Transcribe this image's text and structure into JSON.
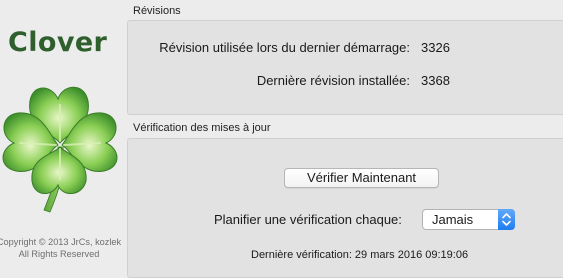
{
  "app": {
    "title": "Clover",
    "copyright_line1": "Copyright © 2013 JrCs, kozlek",
    "copyright_line2": "All Rights Reserved"
  },
  "revisions": {
    "section_title": "Révisions",
    "last_boot_label": "Révision utilisée lors du dernier démarrage:",
    "last_boot_value": "3326",
    "installed_label": "Dernière révision installée:",
    "installed_value": "3368"
  },
  "updates": {
    "section_title": "Vérification des mises à jour",
    "check_now_button": "Vérifier Maintenant",
    "schedule_label": "Planifier une vérification chaque:",
    "schedule_selected": "Jamais",
    "last_check": "Dernière vérification: 29 mars 2016 09:19:06"
  },
  "colors": {
    "brand_green": "#2e5f2c",
    "accent_blue": "#1e7df0"
  },
  "icons": {
    "logo": "clover-leaf-icon",
    "popup": "updown-chevron-icon"
  }
}
